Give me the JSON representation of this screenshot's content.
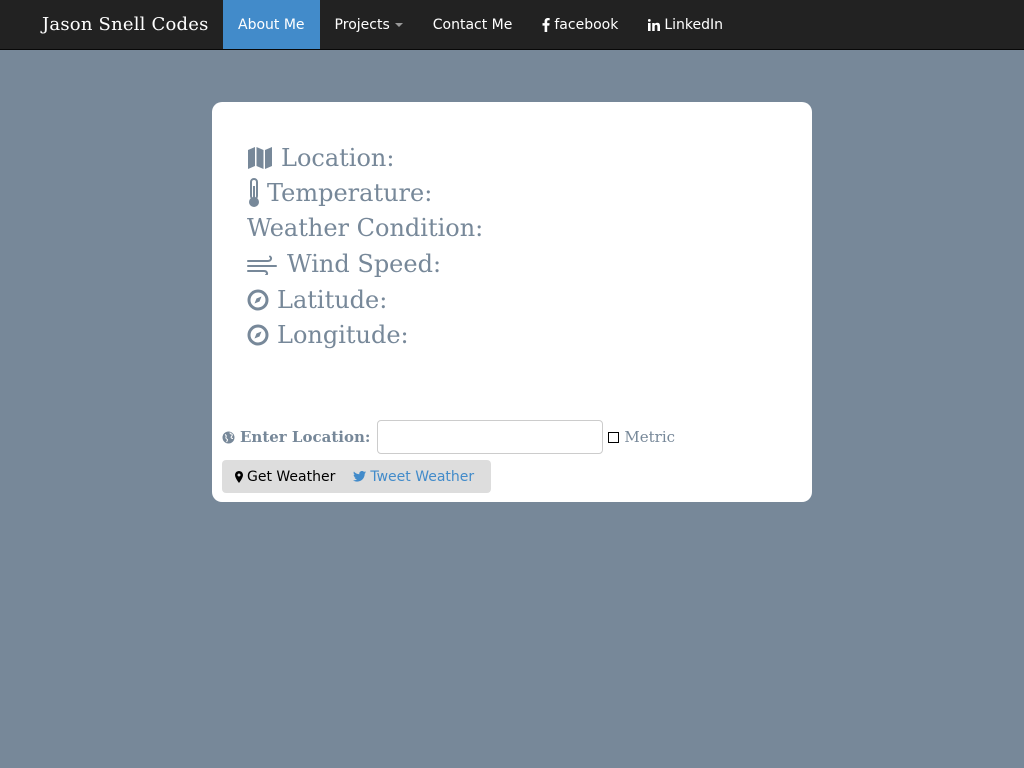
{
  "navbar": {
    "brand": "Jason Snell Codes",
    "items": [
      {
        "label": "About Me",
        "active": true
      },
      {
        "label": "Projects",
        "dropdown": true
      },
      {
        "label": "Contact Me"
      },
      {
        "label": "facebook",
        "icon": "facebook-icon"
      },
      {
        "label": "LinkedIn",
        "icon": "linkedin-icon"
      }
    ]
  },
  "weather": {
    "location_label": "Location:",
    "temperature_label": "Temperature:",
    "condition_label": "Weather Condition:",
    "wind_label": "Wind Speed:",
    "latitude_label": "Latitude:",
    "longitude_label": "Longitude:"
  },
  "form": {
    "enter_location_label": "Enter Location:",
    "location_value": "",
    "location_placeholder": "",
    "metric_label": "Metric",
    "metric_checked": false,
    "get_weather_label": "Get Weather",
    "tweet_weather_label": "Tweet Weather"
  },
  "colors": {
    "background": "#778899",
    "navbar": "#222222",
    "active_nav": "#428bca",
    "label_text": "#778899",
    "tweet_link": "#428bca"
  }
}
